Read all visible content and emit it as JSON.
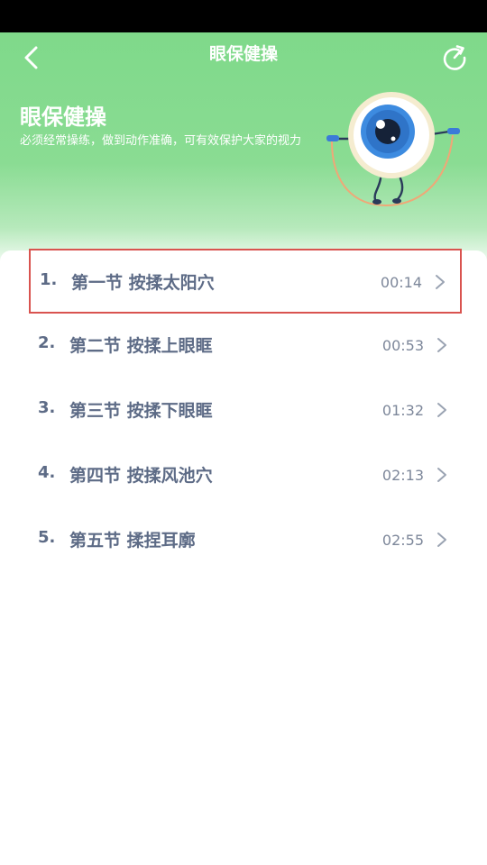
{
  "header": {
    "title": "眼保健操"
  },
  "hero": {
    "title": "眼保健操",
    "description": "必须经常操练，做到动作准确，可有效保护大家的视力"
  },
  "lessons": [
    {
      "index": "1.",
      "title": "第一节 按揉太阳穴",
      "duration": "00:14",
      "selected": true
    },
    {
      "index": "2.",
      "title": "第二节 按揉上眼眶",
      "duration": "00:53",
      "selected": false
    },
    {
      "index": "3.",
      "title": "第三节 按揉下眼眶",
      "duration": "01:32",
      "selected": false
    },
    {
      "index": "4.",
      "title": "第四节 按揉风池穴",
      "duration": "02:13",
      "selected": false
    },
    {
      "index": "5.",
      "title": "第五节 揉捏耳廓",
      "duration": "02:55",
      "selected": false
    }
  ],
  "colors": {
    "header_green": "#7fd98a",
    "text_slate": "#5d6b86",
    "selection_border": "#d9534f"
  },
  "icons": {
    "back": "back-icon",
    "share": "share-icon",
    "mascot": "eyeball-mascot",
    "chevron": "chevron-right-icon"
  }
}
